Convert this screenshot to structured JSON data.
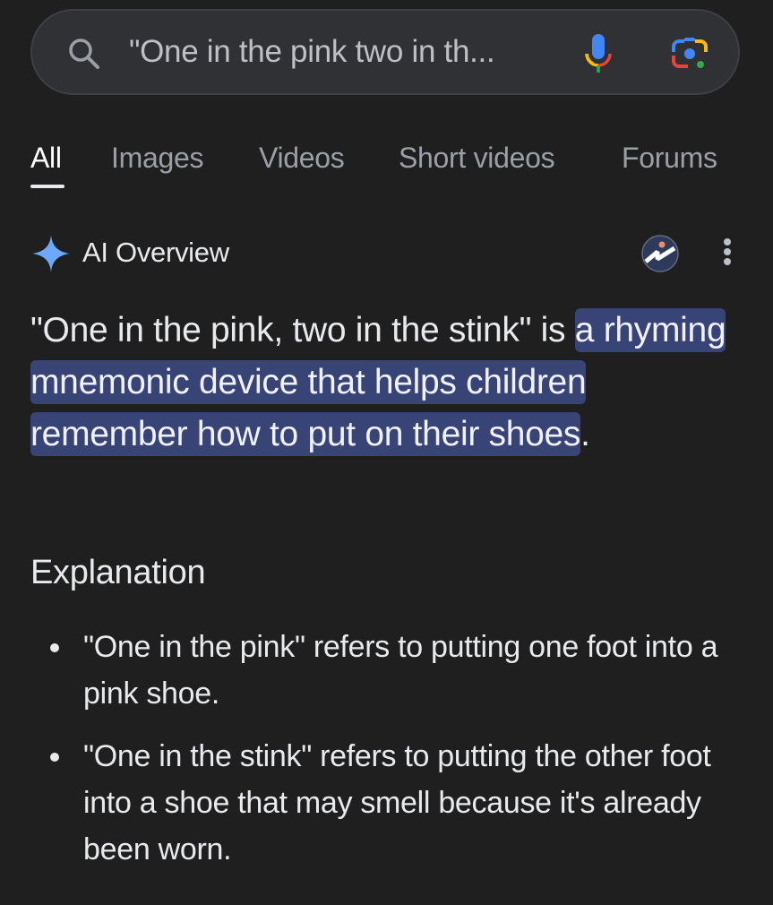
{
  "search": {
    "query": "\"One in the pink two in th...",
    "icons": [
      "search-icon",
      "microphone-icon",
      "google-lens-icon"
    ]
  },
  "tabs": [
    {
      "label": "All",
      "active": true
    },
    {
      "label": "Images",
      "active": false
    },
    {
      "label": "Videos",
      "active": false
    },
    {
      "label": "Short videos",
      "active": false
    },
    {
      "label": "Forums",
      "active": false
    }
  ],
  "ai_overview": {
    "title": "AI Overview",
    "icons": [
      "sparkle-icon",
      "source-avatar-icon",
      "more-options-icon"
    ],
    "summary": {
      "prefix": "\"One in the pink, two in the stink\" is ",
      "highlight": "a rhyming mnemonic device that helps children remember how to put on their shoes",
      "suffix": "."
    },
    "section_title": "Explanation",
    "bullets": [
      "\"One in the pink\" refers to putting one foot into a pink shoe.",
      "\"One in the stink\" refers to putting the other foot into a shoe that may smell because it's already been worn."
    ]
  },
  "colors": {
    "background": "#1f1f1f",
    "search_bar": "#303134",
    "highlight": "#394476",
    "sparkle": "#6ea8fe",
    "tab_inactive": "#9aa0a6",
    "text": "#e8eaed"
  }
}
